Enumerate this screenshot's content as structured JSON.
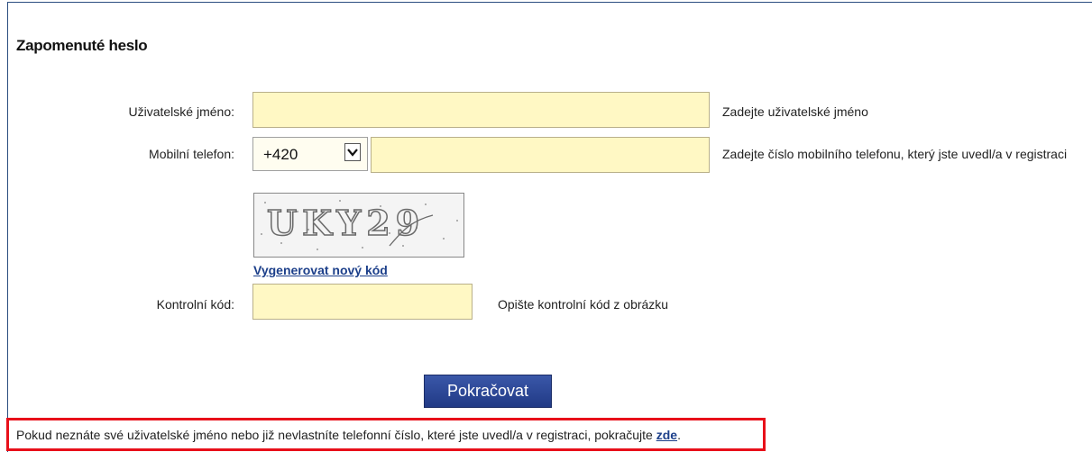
{
  "form": {
    "title": "Zapomenuté heslo",
    "username": {
      "label": "Uživatelské jméno:",
      "value": "",
      "hint": "Zadejte uživatelské jméno"
    },
    "phone": {
      "label": "Mobilní telefon:",
      "prefix_selected": "+420",
      "value": "",
      "hint": "Zadejte číslo mobilního telefonu, který jste uvedl/a v registraci"
    },
    "captcha": {
      "image_text": "UKY29",
      "regenerate_link": "Vygenerovat nový kód"
    },
    "control_code": {
      "label": "Kontrolní kód:",
      "value": "",
      "hint": "Opište kontrolní kód z obrázku"
    },
    "submit_label": "Pokračovat"
  },
  "notice": {
    "text": "Pokud neznáte své uživatelské jméno nebo již nevlastníte telefonní číslo, které jste uvedl/a v registraci, pokračujte ",
    "link": "zde",
    "suffix": "."
  },
  "colors": {
    "field_bg": "#fff8c4",
    "button_bg": "#213a86",
    "link": "#1c3f8a",
    "highlight_border": "#e8101a"
  }
}
